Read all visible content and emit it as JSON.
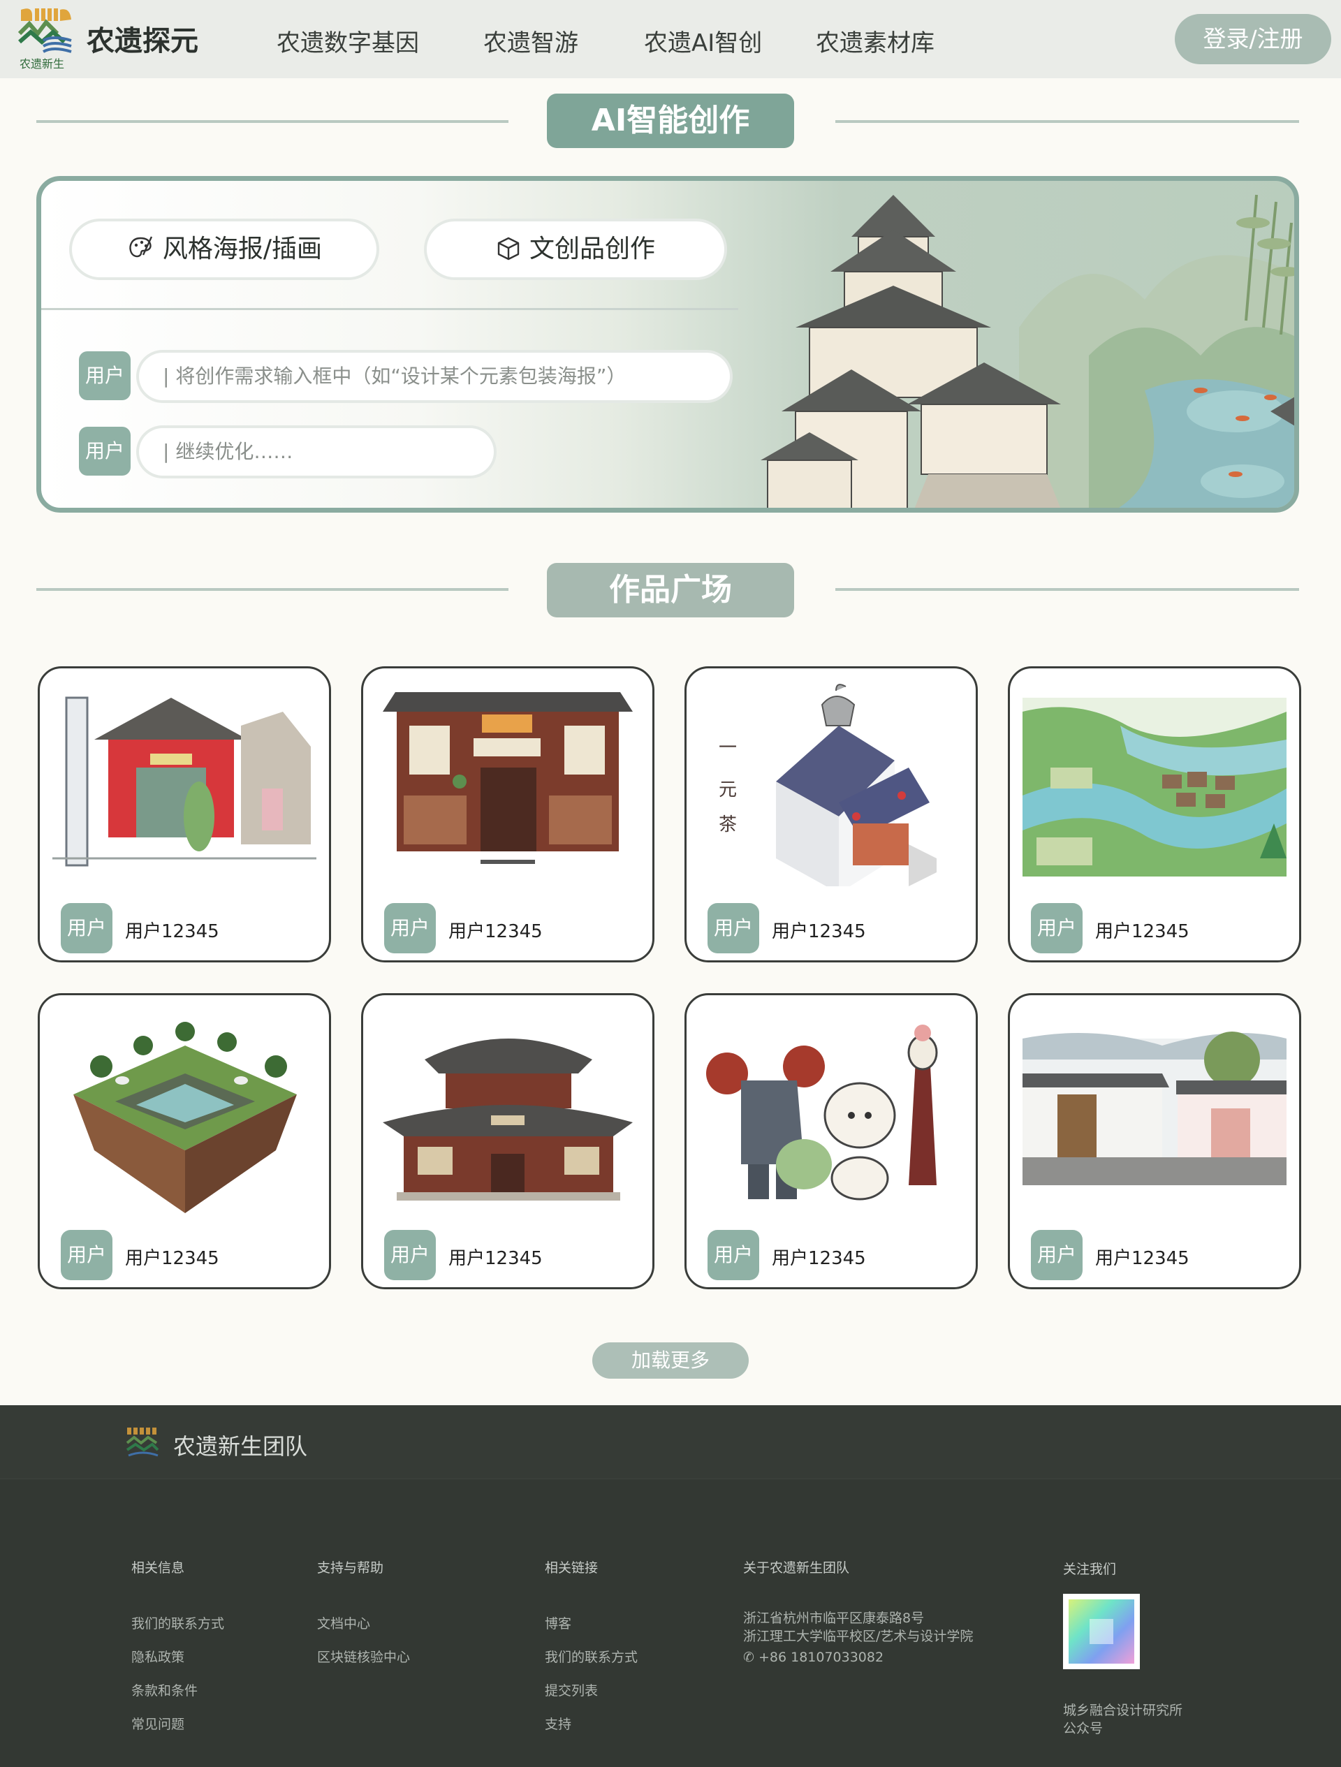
{
  "header": {
    "logo_text": "农遗新生",
    "brand": "农遗探元",
    "nav": [
      "农遗数字基因",
      "农遗智游",
      "农遗AI智创",
      "农遗素材库"
    ],
    "login": "登录/注册"
  },
  "creation": {
    "title": "AI智能创作",
    "tabs": [
      "风格海报/插画",
      "文创品创作"
    ],
    "user_badge": "用户",
    "prompt_placeholder": "将创作需求输入框中（如“设计某个元素包装海报”）",
    "refine_placeholder": "继续优化……"
  },
  "gallery": {
    "title": "作品广场",
    "badge": "用户",
    "cards": [
      {
        "user": "用户12345"
      },
      {
        "user": "用户12345"
      },
      {
        "user": "用户12345"
      },
      {
        "user": "用户12345"
      },
      {
        "user": "用户12345"
      },
      {
        "user": "用户12345"
      },
      {
        "user": "用户12345"
      },
      {
        "user": "用户12345"
      }
    ],
    "load_more": "加载更多"
  },
  "footer": {
    "team": "农遗新生团队",
    "columns": [
      {
        "title": "相关信息",
        "links": [
          "我们的联系方式",
          "隐私政策",
          "条款和条件",
          "常见问题"
        ]
      },
      {
        "title": "支持与帮助",
        "links": [
          "文档中心",
          "区块链核验中心"
        ]
      },
      {
        "title": "相关链接",
        "links": [
          "博客",
          "我们的联系方式",
          "提交列表",
          "支持"
        ]
      }
    ],
    "about": {
      "title": "关于农遗新生团队",
      "address1": "浙江省杭州市临平区康泰路8号",
      "address2": "浙江理工大学临平校区/艺术与设计学院",
      "phone": "+86 18107033082"
    },
    "follow": {
      "title": "关注我们",
      "caption1": "城乡融合设计研究所",
      "caption2": "公众号"
    }
  }
}
